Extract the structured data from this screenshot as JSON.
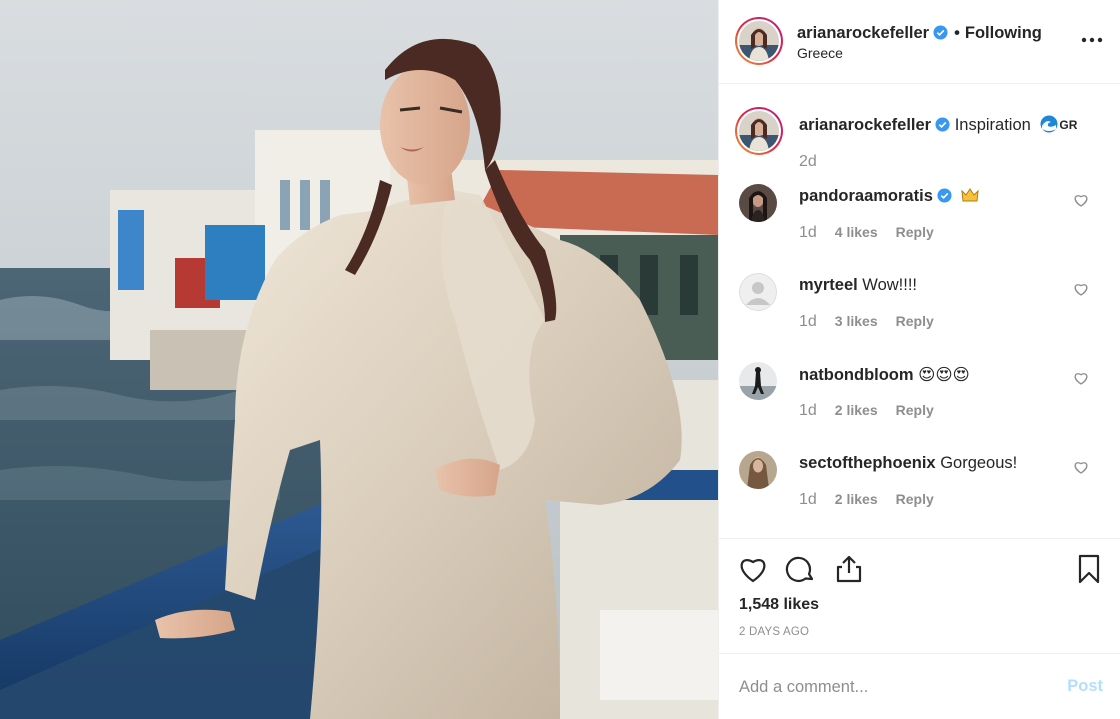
{
  "post": {
    "username": "arianarockefeller",
    "following_label": "Following",
    "location": "Greece",
    "caption": "Inspiration",
    "caption_flag": "GR",
    "caption_time": "2d",
    "likes": "1,548 likes",
    "age": "2 DAYS AGO"
  },
  "comments": [
    {
      "user": "pandoraamoratis",
      "text": "",
      "age": "1d",
      "likes": "4 likes",
      "reply": "Reply",
      "verified": true
    },
    {
      "user": "myrteel",
      "text": "Wow!!!!",
      "age": "1d",
      "likes": "3 likes",
      "reply": "Reply",
      "verified": false
    },
    {
      "user": "natbondbloom",
      "text": "😍😍😍",
      "age": "1d",
      "likes": "2 likes",
      "reply": "Reply",
      "verified": false
    },
    {
      "user": "sectofthephoenix",
      "text": "Gorgeous!",
      "age": "1d",
      "likes": "2 likes",
      "reply": "Reply",
      "verified": false
    }
  ],
  "add_comment": {
    "placeholder": "Add a comment...",
    "post_label": "Post"
  },
  "colors": {
    "accent": "#3897f0",
    "post_disabled": "#b2dffc",
    "secondary_text": "#8e8e8e",
    "divider": "#efefef"
  },
  "icons": [
    "verified-badge-icon",
    "more-options-icon",
    "heart-icon",
    "comment-icon",
    "share-icon",
    "bookmark-icon",
    "crown-emoji-icon",
    "wave-emoji-icon"
  ]
}
